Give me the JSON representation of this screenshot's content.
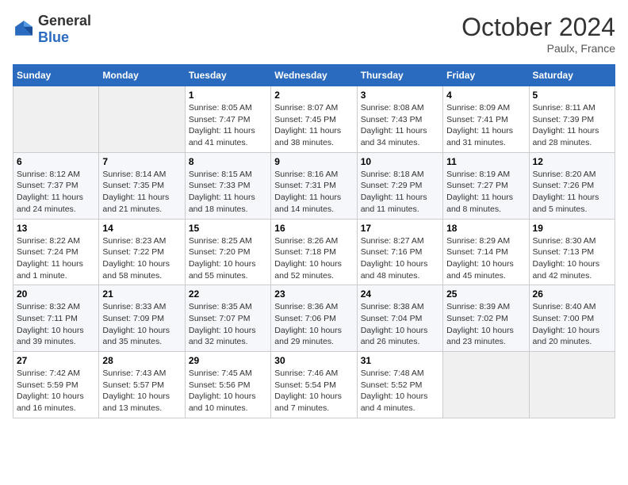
{
  "logo": {
    "general": "General",
    "blue": "Blue"
  },
  "title": "October 2024",
  "location": "Paulx, France",
  "days_header": [
    "Sunday",
    "Monday",
    "Tuesday",
    "Wednesday",
    "Thursday",
    "Friday",
    "Saturday"
  ],
  "weeks": [
    [
      {
        "day": "",
        "info": ""
      },
      {
        "day": "",
        "info": ""
      },
      {
        "day": "1",
        "info": "Sunrise: 8:05 AM\nSunset: 7:47 PM\nDaylight: 11 hours and 41 minutes."
      },
      {
        "day": "2",
        "info": "Sunrise: 8:07 AM\nSunset: 7:45 PM\nDaylight: 11 hours and 38 minutes."
      },
      {
        "day": "3",
        "info": "Sunrise: 8:08 AM\nSunset: 7:43 PM\nDaylight: 11 hours and 34 minutes."
      },
      {
        "day": "4",
        "info": "Sunrise: 8:09 AM\nSunset: 7:41 PM\nDaylight: 11 hours and 31 minutes."
      },
      {
        "day": "5",
        "info": "Sunrise: 8:11 AM\nSunset: 7:39 PM\nDaylight: 11 hours and 28 minutes."
      }
    ],
    [
      {
        "day": "6",
        "info": "Sunrise: 8:12 AM\nSunset: 7:37 PM\nDaylight: 11 hours and 24 minutes."
      },
      {
        "day": "7",
        "info": "Sunrise: 8:14 AM\nSunset: 7:35 PM\nDaylight: 11 hours and 21 minutes."
      },
      {
        "day": "8",
        "info": "Sunrise: 8:15 AM\nSunset: 7:33 PM\nDaylight: 11 hours and 18 minutes."
      },
      {
        "day": "9",
        "info": "Sunrise: 8:16 AM\nSunset: 7:31 PM\nDaylight: 11 hours and 14 minutes."
      },
      {
        "day": "10",
        "info": "Sunrise: 8:18 AM\nSunset: 7:29 PM\nDaylight: 11 hours and 11 minutes."
      },
      {
        "day": "11",
        "info": "Sunrise: 8:19 AM\nSunset: 7:27 PM\nDaylight: 11 hours and 8 minutes."
      },
      {
        "day": "12",
        "info": "Sunrise: 8:20 AM\nSunset: 7:26 PM\nDaylight: 11 hours and 5 minutes."
      }
    ],
    [
      {
        "day": "13",
        "info": "Sunrise: 8:22 AM\nSunset: 7:24 PM\nDaylight: 11 hours and 1 minute."
      },
      {
        "day": "14",
        "info": "Sunrise: 8:23 AM\nSunset: 7:22 PM\nDaylight: 10 hours and 58 minutes."
      },
      {
        "day": "15",
        "info": "Sunrise: 8:25 AM\nSunset: 7:20 PM\nDaylight: 10 hours and 55 minutes."
      },
      {
        "day": "16",
        "info": "Sunrise: 8:26 AM\nSunset: 7:18 PM\nDaylight: 10 hours and 52 minutes."
      },
      {
        "day": "17",
        "info": "Sunrise: 8:27 AM\nSunset: 7:16 PM\nDaylight: 10 hours and 48 minutes."
      },
      {
        "day": "18",
        "info": "Sunrise: 8:29 AM\nSunset: 7:14 PM\nDaylight: 10 hours and 45 minutes."
      },
      {
        "day": "19",
        "info": "Sunrise: 8:30 AM\nSunset: 7:13 PM\nDaylight: 10 hours and 42 minutes."
      }
    ],
    [
      {
        "day": "20",
        "info": "Sunrise: 8:32 AM\nSunset: 7:11 PM\nDaylight: 10 hours and 39 minutes."
      },
      {
        "day": "21",
        "info": "Sunrise: 8:33 AM\nSunset: 7:09 PM\nDaylight: 10 hours and 35 minutes."
      },
      {
        "day": "22",
        "info": "Sunrise: 8:35 AM\nSunset: 7:07 PM\nDaylight: 10 hours and 32 minutes."
      },
      {
        "day": "23",
        "info": "Sunrise: 8:36 AM\nSunset: 7:06 PM\nDaylight: 10 hours and 29 minutes."
      },
      {
        "day": "24",
        "info": "Sunrise: 8:38 AM\nSunset: 7:04 PM\nDaylight: 10 hours and 26 minutes."
      },
      {
        "day": "25",
        "info": "Sunrise: 8:39 AM\nSunset: 7:02 PM\nDaylight: 10 hours and 23 minutes."
      },
      {
        "day": "26",
        "info": "Sunrise: 8:40 AM\nSunset: 7:00 PM\nDaylight: 10 hours and 20 minutes."
      }
    ],
    [
      {
        "day": "27",
        "info": "Sunrise: 7:42 AM\nSunset: 5:59 PM\nDaylight: 10 hours and 16 minutes."
      },
      {
        "day": "28",
        "info": "Sunrise: 7:43 AM\nSunset: 5:57 PM\nDaylight: 10 hours and 13 minutes."
      },
      {
        "day": "29",
        "info": "Sunrise: 7:45 AM\nSunset: 5:56 PM\nDaylight: 10 hours and 10 minutes."
      },
      {
        "day": "30",
        "info": "Sunrise: 7:46 AM\nSunset: 5:54 PM\nDaylight: 10 hours and 7 minutes."
      },
      {
        "day": "31",
        "info": "Sunrise: 7:48 AM\nSunset: 5:52 PM\nDaylight: 10 hours and 4 minutes."
      },
      {
        "day": "",
        "info": ""
      },
      {
        "day": "",
        "info": ""
      }
    ]
  ]
}
